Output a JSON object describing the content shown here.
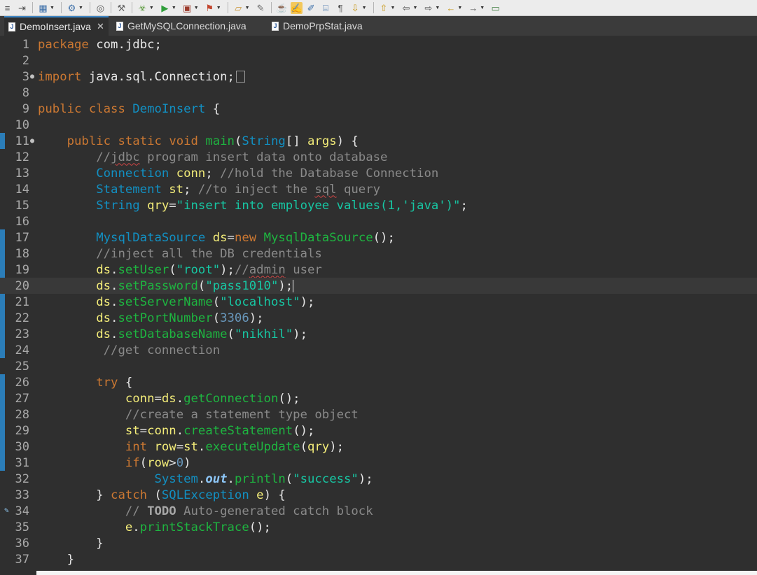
{
  "toolbar": {
    "icons": [
      "list-icon",
      "open-type-icon",
      "new-icon",
      "globe-icon",
      "web-icon",
      "settings-icon",
      "debug-icon",
      "run-icon",
      "run-config-icon",
      "external-tools-icon",
      "open-folder-icon",
      "pen-icon",
      "java-icon",
      "highlight-icon",
      "note-icon",
      "page-icon",
      "pilcrow-icon",
      "nav-down-icon",
      "nav-up-icon",
      "back-icon",
      "forward-icon",
      "arrow-left-icon",
      "arrow-right-icon",
      "window-icon"
    ],
    "glyphs": [
      "≡",
      "⇥",
      "▦",
      "⚙",
      "◎",
      "⚒",
      "☣",
      "▶",
      "▣",
      "⚑",
      "▱",
      "✎",
      "☕",
      "✍",
      "✐",
      "⌸",
      "¶",
      "⇩",
      "⇧",
      "⇦",
      "⇨",
      "←",
      "→",
      "▭"
    ]
  },
  "tabs": [
    {
      "label": "DemoInsert.java",
      "active": true
    },
    {
      "label": "GetMySQLConnection.java",
      "active": false
    },
    {
      "label": "DemoPrpStat.java",
      "active": false
    }
  ],
  "editor": {
    "lines": [
      {
        "n": "1",
        "tokens": [
          [
            "kw",
            "package"
          ],
          [
            "pl",
            " com.jdbc;"
          ]
        ]
      },
      {
        "n": "2",
        "tokens": []
      },
      {
        "n": "3",
        "fold": "⊕",
        "tokens": [
          [
            "kw",
            "import"
          ],
          [
            "pl",
            " java.sql.Connection;"
          ]
        ],
        "collapsed": true
      },
      {
        "n": "8",
        "tokens": []
      },
      {
        "n": "9",
        "tokens": [
          [
            "kw",
            "public"
          ],
          [
            "pl",
            " "
          ],
          [
            "kw",
            "class"
          ],
          [
            "pl",
            " "
          ],
          [
            "ty",
            "DemoInsert"
          ],
          [
            "pl",
            " {"
          ]
        ]
      },
      {
        "n": "10",
        "tokens": []
      },
      {
        "n": "11",
        "fold": "⊖",
        "tokens": [
          [
            "pl",
            "    "
          ],
          [
            "kw",
            "public"
          ],
          [
            "pl",
            " "
          ],
          [
            "kw",
            "static"
          ],
          [
            "pl",
            " "
          ],
          [
            "kw",
            "void"
          ],
          [
            "pl",
            " "
          ],
          [
            "fn",
            "main"
          ],
          [
            "pl",
            "("
          ],
          [
            "ty",
            "String"
          ],
          [
            "pl",
            "[] "
          ],
          [
            "var",
            "args"
          ],
          [
            "pl",
            ") {"
          ]
        ]
      },
      {
        "n": "12",
        "tokens": [
          [
            "pl",
            "        "
          ],
          [
            "cm",
            "//"
          ],
          [
            "cmsq",
            "jdbc"
          ],
          [
            "cm",
            " program insert data onto database"
          ]
        ]
      },
      {
        "n": "13",
        "tokens": [
          [
            "pl",
            "        "
          ],
          [
            "ty",
            "Connection"
          ],
          [
            "pl",
            " "
          ],
          [
            "var",
            "conn"
          ],
          [
            "pl",
            "; "
          ],
          [
            "cm",
            "//hold the Database Connection"
          ]
        ]
      },
      {
        "n": "14",
        "tokens": [
          [
            "pl",
            "        "
          ],
          [
            "ty",
            "Statement"
          ],
          [
            "pl",
            " "
          ],
          [
            "var",
            "st"
          ],
          [
            "pl",
            "; "
          ],
          [
            "cm",
            "//to inject the "
          ],
          [
            "cmsq",
            "sql"
          ],
          [
            "cm",
            " query"
          ]
        ]
      },
      {
        "n": "15",
        "tokens": [
          [
            "pl",
            "        "
          ],
          [
            "ty",
            "String"
          ],
          [
            "pl",
            " "
          ],
          [
            "var",
            "qry"
          ],
          [
            "pl",
            "="
          ],
          [
            "str",
            "\"insert into employee values(1,'java')\""
          ],
          [
            "pl",
            ";"
          ]
        ]
      },
      {
        "n": "16",
        "tokens": []
      },
      {
        "n": "17",
        "tokens": [
          [
            "pl",
            "        "
          ],
          [
            "ty",
            "MysqlDataSource"
          ],
          [
            "pl",
            " "
          ],
          [
            "var",
            "ds"
          ],
          [
            "pl",
            "="
          ],
          [
            "kw",
            "new"
          ],
          [
            "pl",
            " "
          ],
          [
            "fn",
            "MysqlDataSource"
          ],
          [
            "pl",
            "();"
          ]
        ]
      },
      {
        "n": "18",
        "tokens": [
          [
            "pl",
            "        "
          ],
          [
            "cm",
            "//inject all the DB credentials"
          ]
        ]
      },
      {
        "n": "19",
        "tokens": [
          [
            "pl",
            "        "
          ],
          [
            "var",
            "ds"
          ],
          [
            "pl",
            "."
          ],
          [
            "fn",
            "setUser"
          ],
          [
            "pl",
            "("
          ],
          [
            "str",
            "\"root\""
          ],
          [
            "pl",
            ");"
          ],
          [
            "cm",
            "//"
          ],
          [
            "cmsq",
            "admin"
          ],
          [
            "cm",
            " user"
          ]
        ]
      },
      {
        "n": "20",
        "current": true,
        "tokens": [
          [
            "pl",
            "        "
          ],
          [
            "var",
            "ds"
          ],
          [
            "pl",
            "."
          ],
          [
            "fn",
            "setPassword"
          ],
          [
            "pl",
            "("
          ],
          [
            "str",
            "\"pass1010\""
          ],
          [
            "pl",
            ");"
          ],
          [
            "caret",
            ""
          ]
        ]
      },
      {
        "n": "21",
        "tokens": [
          [
            "pl",
            "        "
          ],
          [
            "var",
            "ds"
          ],
          [
            "pl",
            "."
          ],
          [
            "fn",
            "setServerName"
          ],
          [
            "pl",
            "("
          ],
          [
            "str",
            "\"localhost\""
          ],
          [
            "pl",
            ");"
          ]
        ]
      },
      {
        "n": "22",
        "tokens": [
          [
            "pl",
            "        "
          ],
          [
            "var",
            "ds"
          ],
          [
            "pl",
            "."
          ],
          [
            "fn",
            "setPortNumber"
          ],
          [
            "pl",
            "("
          ],
          [
            "num",
            "3306"
          ],
          [
            "pl",
            ");"
          ]
        ]
      },
      {
        "n": "23",
        "tokens": [
          [
            "pl",
            "        "
          ],
          [
            "var",
            "ds"
          ],
          [
            "pl",
            "."
          ],
          [
            "fn",
            "setDatabaseName"
          ],
          [
            "pl",
            "("
          ],
          [
            "str",
            "\"nikhil\""
          ],
          [
            "pl",
            ");"
          ]
        ]
      },
      {
        "n": "24",
        "tokens": [
          [
            "pl",
            "         "
          ],
          [
            "cm",
            "//get connection"
          ]
        ]
      },
      {
        "n": "25",
        "tokens": []
      },
      {
        "n": "26",
        "tokens": [
          [
            "pl",
            "        "
          ],
          [
            "kw",
            "try"
          ],
          [
            "pl",
            " {"
          ]
        ]
      },
      {
        "n": "27",
        "tokens": [
          [
            "pl",
            "            "
          ],
          [
            "var",
            "conn"
          ],
          [
            "pl",
            "="
          ],
          [
            "var",
            "ds"
          ],
          [
            "pl",
            "."
          ],
          [
            "fn",
            "getConnection"
          ],
          [
            "pl",
            "();"
          ]
        ]
      },
      {
        "n": "28",
        "tokens": [
          [
            "pl",
            "            "
          ],
          [
            "cm",
            "//create a statement type object"
          ]
        ]
      },
      {
        "n": "29",
        "tokens": [
          [
            "pl",
            "            "
          ],
          [
            "var",
            "st"
          ],
          [
            "pl",
            "="
          ],
          [
            "var",
            "conn"
          ],
          [
            "pl",
            "."
          ],
          [
            "fn",
            "createStatement"
          ],
          [
            "pl",
            "();"
          ]
        ]
      },
      {
        "n": "30",
        "tokens": [
          [
            "pl",
            "            "
          ],
          [
            "kw",
            "int"
          ],
          [
            "pl",
            " "
          ],
          [
            "var",
            "row"
          ],
          [
            "pl",
            "="
          ],
          [
            "var",
            "st"
          ],
          [
            "pl",
            "."
          ],
          [
            "fn",
            "executeUpdate"
          ],
          [
            "pl",
            "("
          ],
          [
            "var",
            "qry"
          ],
          [
            "pl",
            ");"
          ]
        ]
      },
      {
        "n": "31",
        "tokens": [
          [
            "pl",
            "            "
          ],
          [
            "kw",
            "if"
          ],
          [
            "pl",
            "("
          ],
          [
            "var",
            "row"
          ],
          [
            "pl",
            ">"
          ],
          [
            "num",
            "0"
          ],
          [
            "pl",
            ")"
          ]
        ]
      },
      {
        "n": "32",
        "tokens": [
          [
            "pl",
            "                "
          ],
          [
            "ty",
            "System"
          ],
          [
            "pl",
            "."
          ],
          [
            "st",
            "out"
          ],
          [
            "pl",
            "."
          ],
          [
            "fn",
            "println"
          ],
          [
            "pl",
            "("
          ],
          [
            "str",
            "\"success\""
          ],
          [
            "pl",
            ");"
          ]
        ]
      },
      {
        "n": "33",
        "tokens": [
          [
            "pl",
            "        } "
          ],
          [
            "kw",
            "catch"
          ],
          [
            "pl",
            " ("
          ],
          [
            "ty",
            "SQLException"
          ],
          [
            "pl",
            " "
          ],
          [
            "var",
            "e"
          ],
          [
            "pl",
            ") {"
          ]
        ]
      },
      {
        "n": "34",
        "marker": true,
        "tokens": [
          [
            "pl",
            "            "
          ],
          [
            "cm",
            "// "
          ],
          [
            "todo",
            "TODO"
          ],
          [
            "cm",
            " Auto-generated catch block"
          ]
        ]
      },
      {
        "n": "35",
        "tokens": [
          [
            "pl",
            "            "
          ],
          [
            "var",
            "e"
          ],
          [
            "pl",
            "."
          ],
          [
            "fn",
            "printStackTrace"
          ],
          [
            "pl",
            "();"
          ]
        ]
      },
      {
        "n": "36",
        "tokens": [
          [
            "pl",
            "        }"
          ]
        ]
      },
      {
        "n": "37",
        "tokens": [
          [
            "pl",
            "    }"
          ]
        ]
      }
    ]
  }
}
